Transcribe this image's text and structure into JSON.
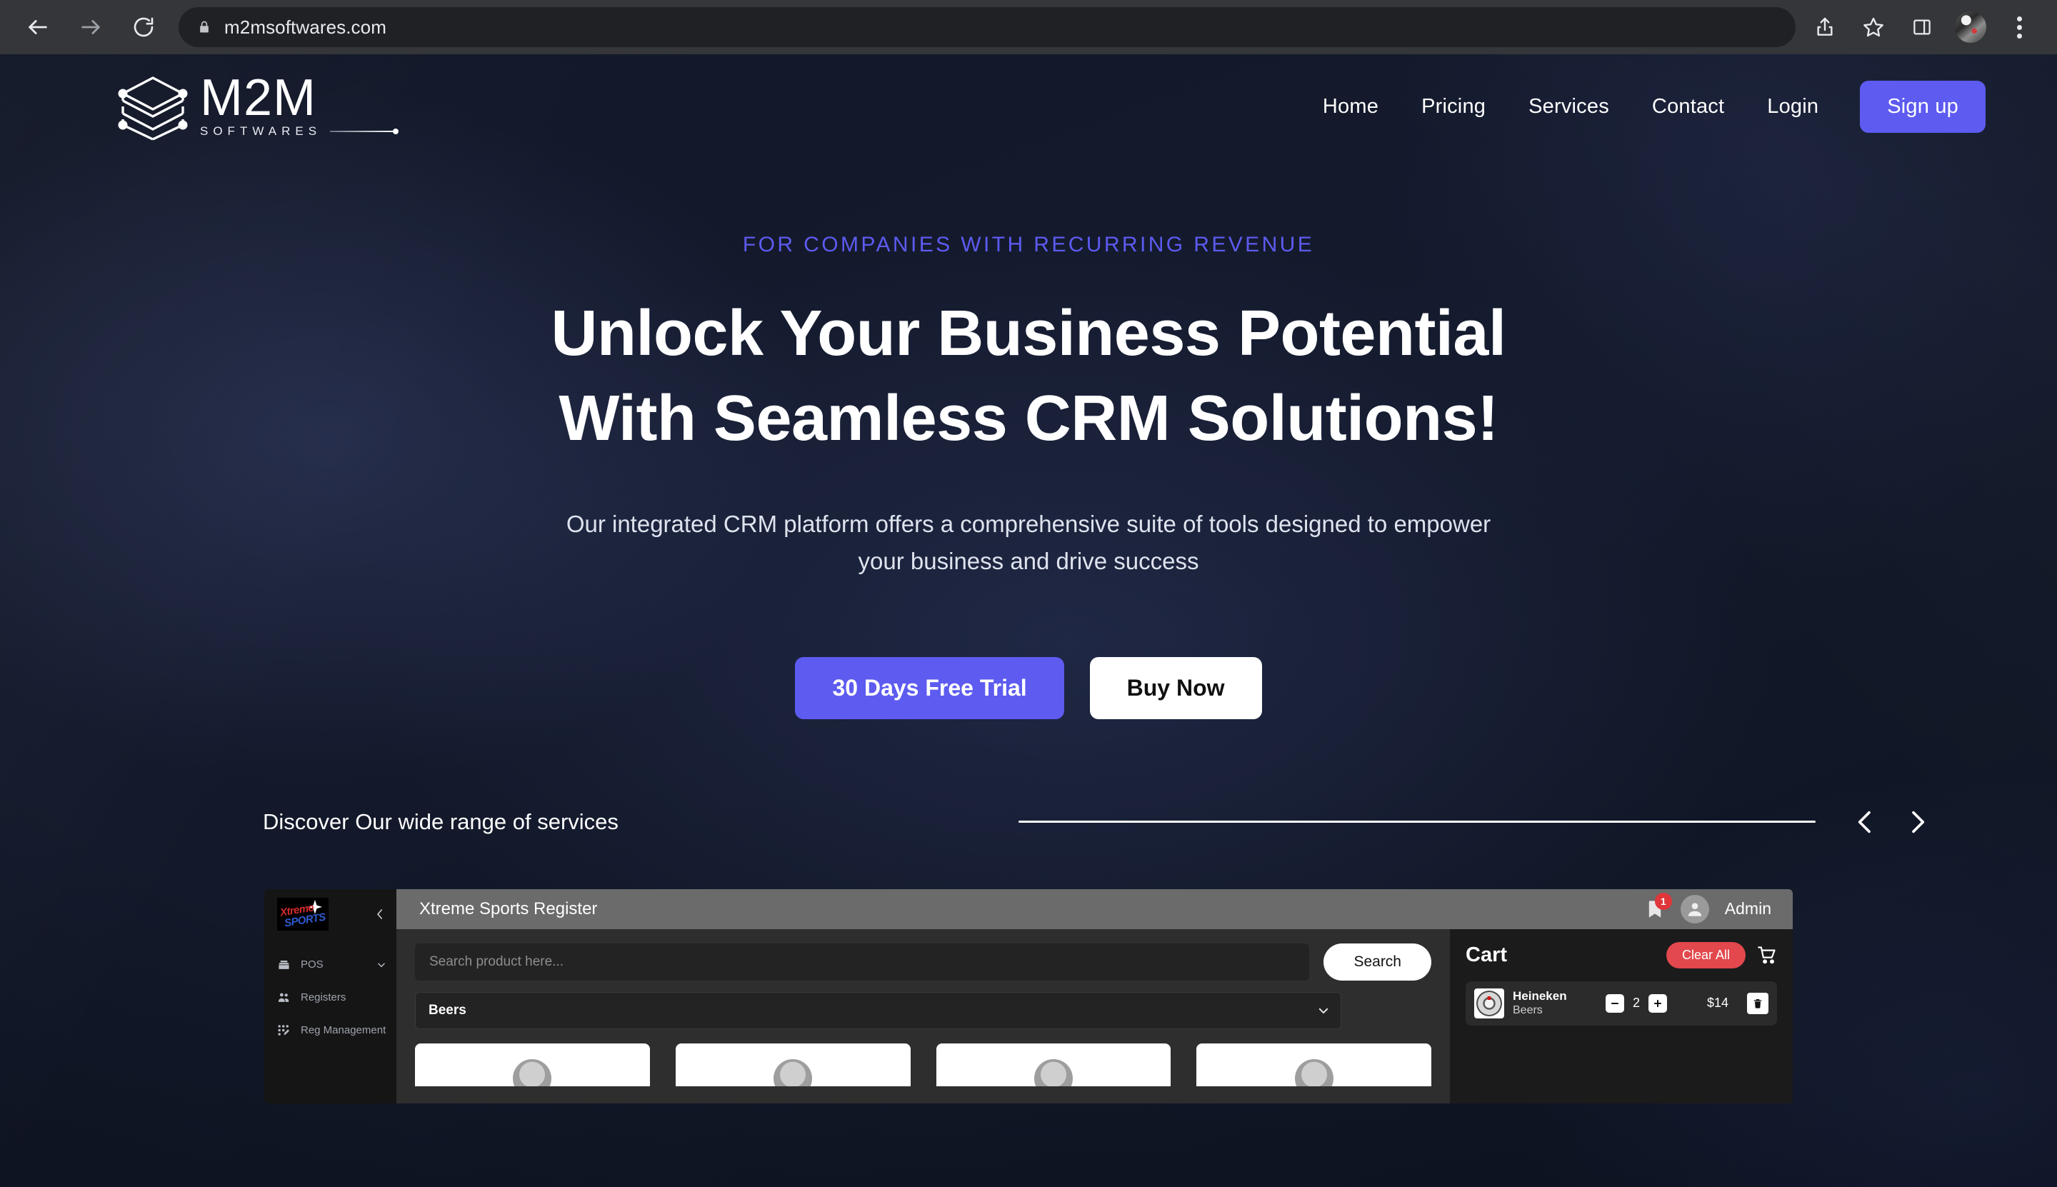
{
  "browser": {
    "url": "m2msoftwares.com",
    "back_label": "Back",
    "forward_label": "Forward",
    "reload_label": "Reload",
    "lock_icon": "lock-icon",
    "share_label": "Share",
    "bookmark_label": "Bookmark this tab",
    "side_panel_label": "Side panel",
    "profile_label": "Profile",
    "menu_label": "Customize and control Google Chrome"
  },
  "header": {
    "logo_text": "M2M",
    "logo_sub": "SOFTWARES",
    "nav": [
      {
        "label": "Home"
      },
      {
        "label": "Pricing"
      },
      {
        "label": "Services"
      },
      {
        "label": "Contact"
      },
      {
        "label": "Login"
      }
    ],
    "signup_label": "Sign up"
  },
  "hero": {
    "eyebrow": "FOR COMPANIES WITH RECURRING REVENUE",
    "title_line1": "Unlock Your Business Potential",
    "title_line2": "With Seamless CRM Solutions!",
    "subtitle": "Our integrated CRM platform offers a comprehensive suite of tools designed to empower your business and drive success",
    "cta_primary": "30 Days Free Trial",
    "cta_secondary": "Buy Now",
    "accent_color": "#5d5bf0"
  },
  "services": {
    "title": "Discover Our wide range of services",
    "prev_label": "Previous",
    "next_label": "Next"
  },
  "app_preview": {
    "brand_name": "Xtreme Sports",
    "window_title": "Xtreme Sports Register",
    "collapse_label": "Collapse sidebar",
    "sidebar": [
      {
        "label": "POS",
        "icon": "register-icon",
        "has_chevron": true
      },
      {
        "label": "Registers",
        "icon": "users-icon",
        "has_chevron": false
      },
      {
        "label": "Reg Management",
        "icon": "grid-edit-icon",
        "has_chevron": false
      }
    ],
    "notification_count": "1",
    "user_name": "Admin",
    "search_placeholder": "Search product here...",
    "search_value": "",
    "search_button": "Search",
    "category_selected": "Beers",
    "category_options": [
      "Beers"
    ],
    "cart": {
      "title": "Cart",
      "clear_label": "Clear All",
      "items": [
        {
          "name": "Heineken",
          "category": "Beers",
          "quantity": "2",
          "price": "$14",
          "decrease_label": "−",
          "increase_label": "+",
          "remove_label": "Remove"
        }
      ]
    }
  }
}
